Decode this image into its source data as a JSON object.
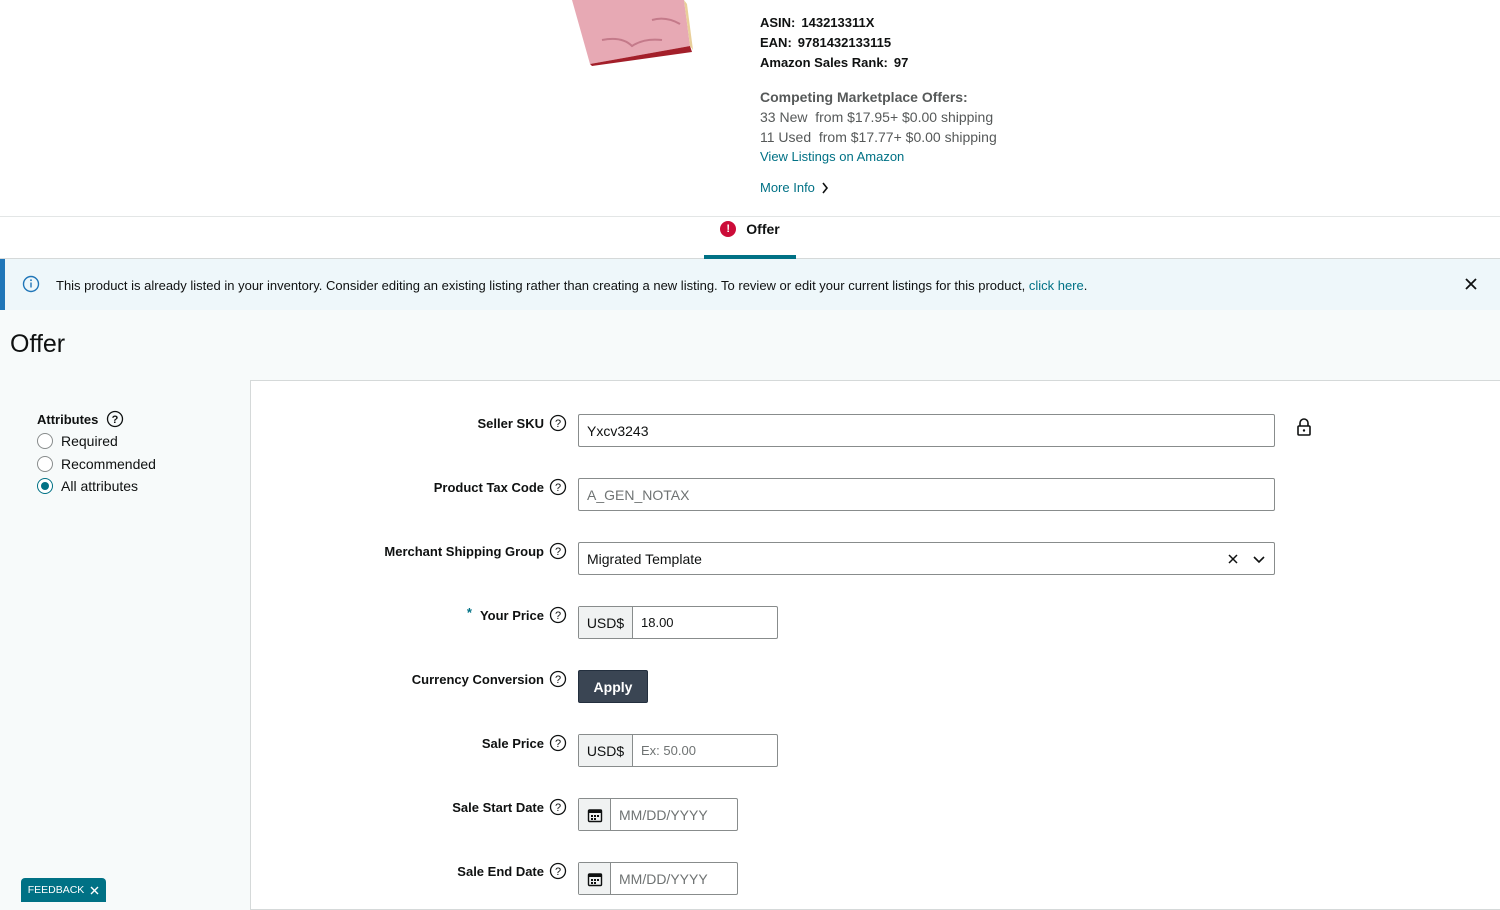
{
  "product": {
    "asin_label": "ASIN:",
    "asin": "143213311X",
    "ean_label": "EAN:",
    "ean": "9781432133115",
    "rank_label": "Amazon Sales Rank:",
    "rank": "97",
    "competing_title": "Competing Marketplace Offers:",
    "new_offers": "33 New  from $17.95+ $0.00 shipping",
    "used_offers": "11 Used  from $17.77+ $0.00 shipping",
    "view_listings": "View Listings on Amazon",
    "more_info": "More Info"
  },
  "tab": {
    "label": "Offer",
    "error_mark": "!"
  },
  "alert": {
    "message": "This product is already listed in your inventory. Consider editing an existing listing rather than creating a new listing. To review or edit your current listings for this product, ",
    "link": "click here",
    "end": "."
  },
  "page_title": "Offer",
  "attributes": {
    "heading": "Attributes",
    "options": [
      "Required",
      "Recommended",
      "All attributes"
    ],
    "selected": "All attributes"
  },
  "form": {
    "seller_sku": {
      "label": "Seller SKU",
      "value": "Yxcv3243"
    },
    "product_tax_code": {
      "label": "Product Tax Code",
      "placeholder": "A_GEN_NOTAX"
    },
    "shipping_group": {
      "label": "Merchant Shipping Group",
      "value": "Migrated Template"
    },
    "your_price": {
      "label": "Your Price",
      "required_mark": "*",
      "currency": "USD$",
      "value": "18.00"
    },
    "currency_conversion": {
      "label": "Currency Conversion",
      "button": "Apply"
    },
    "sale_price": {
      "label": "Sale Price",
      "currency": "USD$",
      "placeholder": "Ex: 50.00"
    },
    "sale_start": {
      "label": "Sale Start Date",
      "placeholder": "MM/DD/YYYY"
    },
    "sale_end": {
      "label": "Sale End Date",
      "placeholder": "MM/DD/YYYY"
    }
  },
  "feedback": "FEEDBACK",
  "colors": {
    "accent": "#007185",
    "error": "#cc0c39",
    "alert_bg": "#eef7fa",
    "button": "#3a4553"
  }
}
